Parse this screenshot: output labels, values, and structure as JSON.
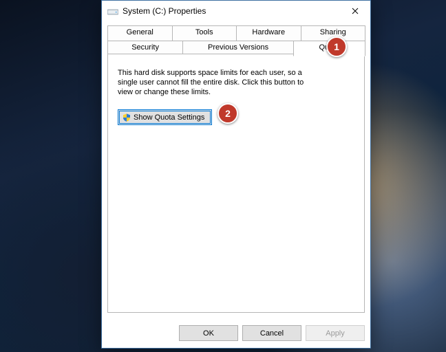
{
  "window": {
    "title": "System (C:) Properties"
  },
  "tabs": {
    "row1": [
      "General",
      "Tools",
      "Hardware",
      "Sharing"
    ],
    "row2": [
      "Security",
      "Previous Versions",
      "Quota"
    ],
    "selected": "Quota"
  },
  "quota_panel": {
    "description": "This hard disk supports space limits for each user, so a single user cannot fill the entire disk. Click this button to view or change these limits.",
    "button_label": "Show Quota Settings"
  },
  "footer": {
    "ok": "OK",
    "cancel": "Cancel",
    "apply": "Apply"
  },
  "annotations": {
    "a1": "1",
    "a2": "2"
  }
}
